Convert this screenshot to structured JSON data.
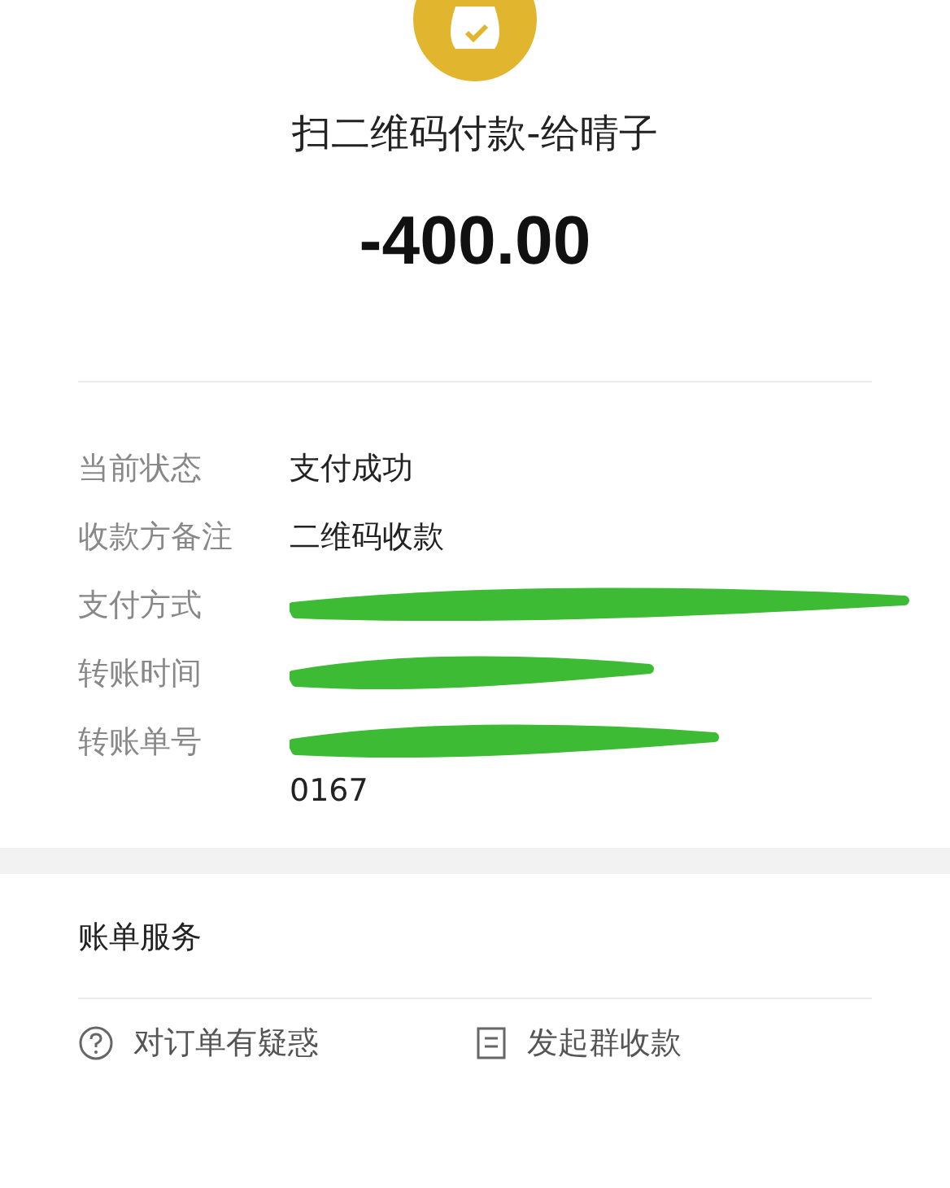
{
  "header": {
    "title": "扫二维码付款-给晴子",
    "amount": "-400.00"
  },
  "details": [
    {
      "label": "当前状态",
      "value": "支付成功",
      "redacted": false
    },
    {
      "label": "收款方备注",
      "value": "二维码收款",
      "redacted": false
    },
    {
      "label": "支付方式",
      "redacted": true
    },
    {
      "label": "转账时间",
      "redacted": true
    },
    {
      "label": "转账单号",
      "redacted": true,
      "tail": "0167"
    }
  ],
  "services": {
    "title": "账单服务",
    "actions": [
      {
        "label": "对订单有疑惑",
        "kind": "question"
      },
      {
        "label": "发起群收款",
        "kind": "group"
      }
    ]
  }
}
